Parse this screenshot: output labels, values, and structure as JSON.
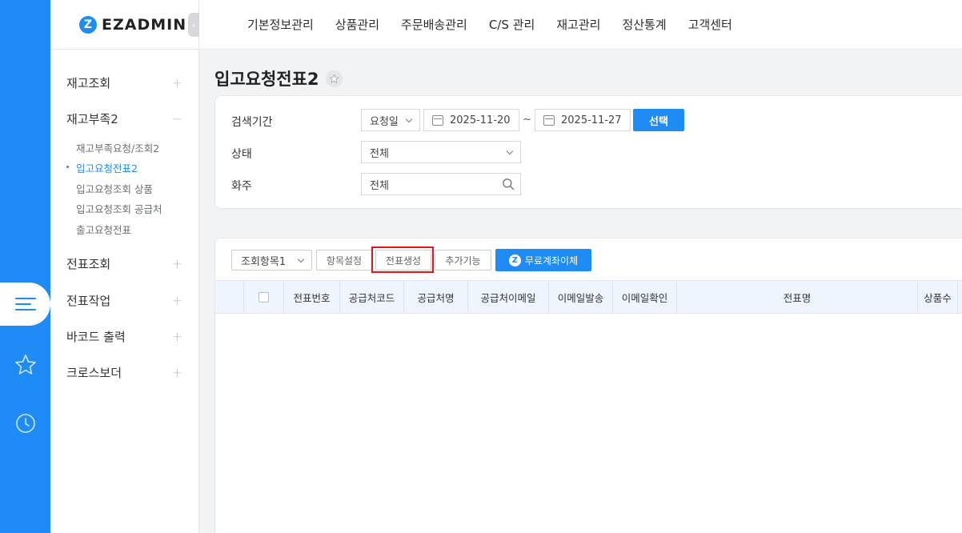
{
  "brand": {
    "logo_text": "EZADMIN"
  },
  "topnav": [
    "기본정보관리",
    "상품관리",
    "주문배송관리",
    "C/S 관리",
    "재고관리",
    "정산통계",
    "고객센터"
  ],
  "sidebar": {
    "groups": [
      {
        "label": "재고조회",
        "sign": "+"
      },
      {
        "label": "재고부족2",
        "sign": "−"
      },
      {
        "label": "전표조회",
        "sign": "+"
      },
      {
        "label": "전표작업",
        "sign": "+"
      },
      {
        "label": "바코드 출력",
        "sign": "+"
      },
      {
        "label": "크로스보더",
        "sign": "+"
      }
    ],
    "sub_items": [
      "재고부족요청/조회2",
      "입고요청전표2",
      "입고요청조회 상품",
      "입고요청조회 공급처",
      "출고요청전표"
    ],
    "active_sub_item": "입고요청전표2"
  },
  "page": {
    "title": "입고요청전표2"
  },
  "search": {
    "period_label": "검색기간",
    "date_type": "요청일",
    "date_from": "2025-11-20",
    "date_sep": "~",
    "date_to": "2025-11-27",
    "select_button": "선택",
    "status_label": "상태",
    "status_value": "전체",
    "owner_label": "화주",
    "owner_value": "전체"
  },
  "toolbar": {
    "view_select": "조회항목1",
    "item_settings": "항목설정",
    "create_slip": "전표생성",
    "extra_function": "추가기능",
    "free_transfer": "무료계좌이체"
  },
  "table": {
    "columns": [
      "전표번호",
      "공급처코드",
      "공급처명",
      "공급처이메일",
      "이메일발송",
      "이메일확인",
      "전표명",
      "상품수"
    ]
  },
  "colors": {
    "accent": "#1f8cf5",
    "highlight": "#e3141c"
  }
}
